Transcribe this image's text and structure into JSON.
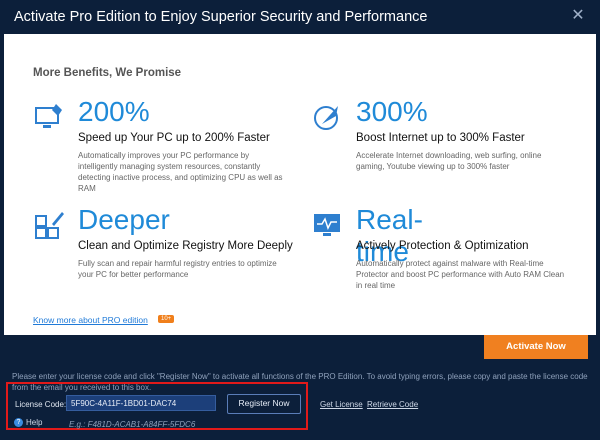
{
  "window": {
    "title": "Activate Pro Edition to Enjoy Superior Security and Performance",
    "close_icon": "close-icon"
  },
  "panel": {
    "heading": "More Benefits, We Promise",
    "benefits": [
      {
        "icon": "pc-speed-icon",
        "big": "200%",
        "sub": "Speed up Your PC up to 200% Faster",
        "desc": "Automatically improves your PC performance by intelligently managing system resources, constantly detecting inactive process, and optimizing CPU as well as RAM"
      },
      {
        "icon": "rocket-icon",
        "big": "300%",
        "sub": "Boost Internet up to 300% Faster",
        "desc": "Accelerate Internet downloading, web surfing, online gaming, Youtube viewing up to 300% faster"
      },
      {
        "icon": "registry-clean-icon",
        "big": "Deeper",
        "sub": "Clean and Optimize Registry More Deeply",
        "desc": "Fully scan and repair harmful registry entries to optimize your PC for better performance"
      },
      {
        "icon": "monitor-pulse-icon",
        "big": "Real-time",
        "sub": "Actively Protection & Optimization",
        "desc": "Automatically protect against malware with Real-time Protector and boost PC performance with Auto RAM Clean in real time"
      }
    ],
    "know_more": "Know more about PRO edition",
    "badge": "10+"
  },
  "activate_label": "Activate Now",
  "instructions": "Please enter your license code and click \"Register Now\" to activate all functions of the PRO Edition. To avoid typing errors, please copy and paste the license code from the email you received to this box.",
  "license": {
    "label": "License Code:",
    "value": "5F90C-4A11F-1BD01-DAC74",
    "example": "E.g.: F481D-ACAB1-A84FF-5FDC6"
  },
  "register_label": "Register Now",
  "get_license": "Get License",
  "retrieve_code": "Retrieve Code",
  "help": "Help",
  "colors": {
    "accent_blue": "#1f8ad8",
    "orange": "#f08020",
    "highlight_red": "#e11a1a",
    "background": "#0c1f3a"
  }
}
